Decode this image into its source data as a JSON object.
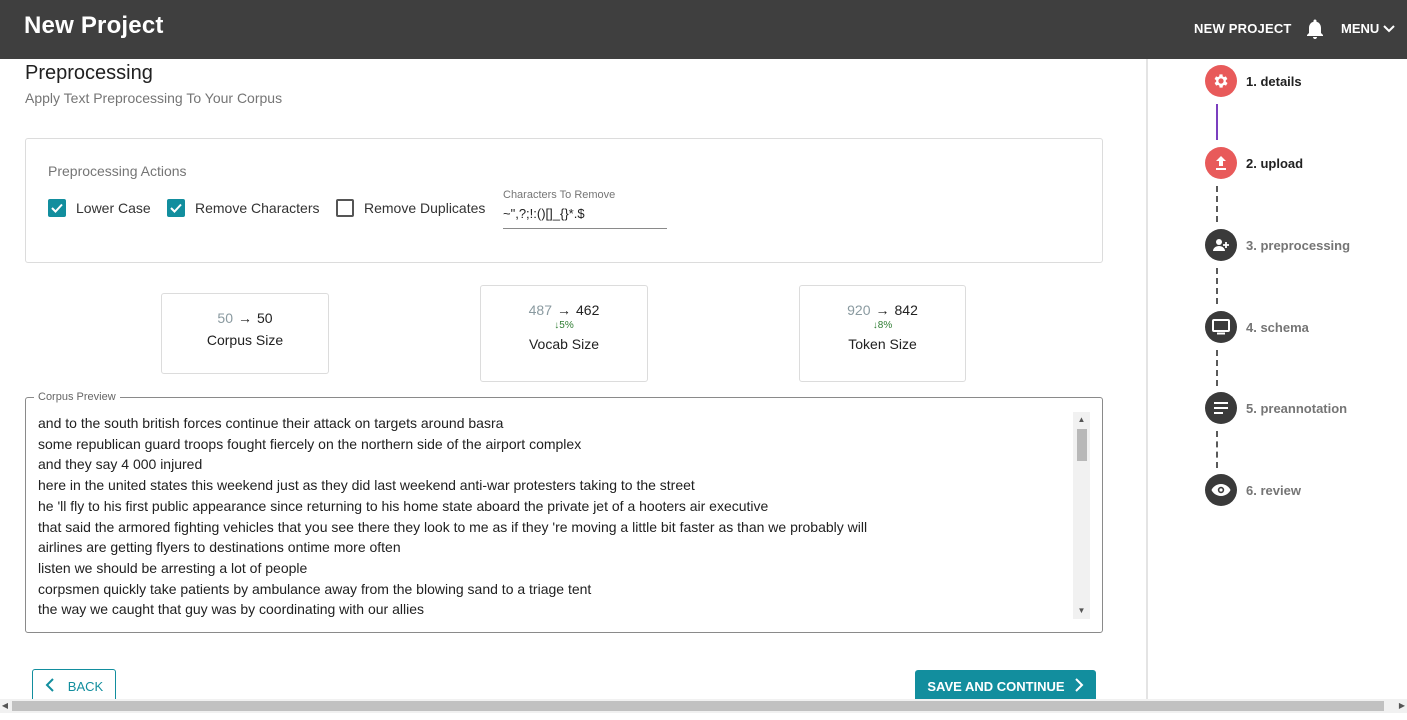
{
  "app": {
    "title": "New Project"
  },
  "header": {
    "new_project_label": "NEW PROJECT",
    "menu_label": "MENU"
  },
  "page": {
    "heading": "Preprocessing",
    "subheading": "Apply Text Preprocessing To Your Corpus"
  },
  "actions": {
    "label": "Preprocessing Actions",
    "lower_case": {
      "label": "Lower Case",
      "checked": true
    },
    "remove_characters": {
      "label": "Remove Characters",
      "checked": true
    },
    "remove_duplicates": {
      "label": "Remove Duplicates",
      "checked": false
    },
    "characters_field": {
      "label": "Characters To Remove",
      "value": "~\",?;!:()[]_{}*.$"
    }
  },
  "stats": {
    "corpus": {
      "before": "50",
      "after": "50",
      "name": "Corpus Size"
    },
    "vocab": {
      "before": "487",
      "after": "462",
      "delta": "5%",
      "name": "Vocab Size"
    },
    "token": {
      "before": "920",
      "after": "842",
      "delta": "8%",
      "name": "Token Size"
    }
  },
  "preview": {
    "label": "Corpus Preview",
    "lines": [
      "and to the south british forces continue their attack on targets around basra",
      "some republican guard troops fought fiercely on the northern side of the airport complex",
      "and they say 4 000 injured",
      "here in the united states this weekend just as they did last weekend anti-war protesters taking to the street",
      "he 'll fly to his first public appearance since returning to his home state aboard the private jet of a hooters air executive",
      "that said the armored fighting vehicles that you see there they look to me as if they 're moving a little bit faster as than we probably will",
      "airlines are getting flyers to destinations ontime more often",
      "listen we should be arresting a lot of people",
      "corpsmen quickly take patients by ambulance away from the blowing sand to a triage tent",
      "the way we caught that guy was by coordinating with our allies"
    ]
  },
  "buttons": {
    "back": "BACK",
    "save": "SAVE AND CONTINUE"
  },
  "stepper": {
    "steps": [
      {
        "label": "1. details",
        "icon": "gear-icon",
        "state": "active"
      },
      {
        "label": "2. upload",
        "icon": "upload-icon",
        "state": "active"
      },
      {
        "label": "3. preprocessing",
        "icon": "group-add-icon",
        "state": "inactive"
      },
      {
        "label": "4. schema",
        "icon": "monitor-icon",
        "state": "inactive"
      },
      {
        "label": "5. preannotation",
        "icon": "notes-icon",
        "state": "inactive"
      },
      {
        "label": "6. review",
        "icon": "eye-icon",
        "state": "inactive"
      }
    ]
  },
  "colors": {
    "accent": "#128e9e",
    "appbar": "#3f3f3f",
    "active_step": "#e85a5a",
    "connector_active": "#7b3fbf",
    "delta_green": "#2e7d32"
  }
}
